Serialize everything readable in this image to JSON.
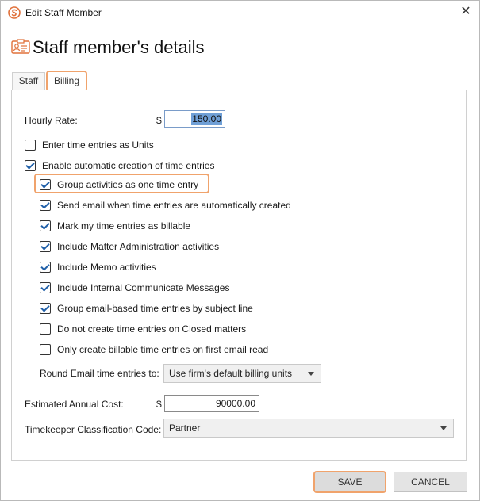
{
  "window": {
    "title": "Edit Staff Member"
  },
  "header": {
    "title": "Staff member's details"
  },
  "tabs": [
    {
      "label": "Staff",
      "active": false
    },
    {
      "label": "Billing",
      "active": true
    }
  ],
  "billing": {
    "hourly_rate_label": "Hourly Rate:",
    "currency_symbol": "$",
    "hourly_rate_value": "150.00",
    "options": [
      {
        "label": "Enter time entries as Units",
        "checked": false
      },
      {
        "label": "Enable automatic creation of time entries",
        "checked": true
      },
      {
        "label": "Group activities as one time entry",
        "checked": true
      },
      {
        "label": "Send email when time entries are automatically created",
        "checked": true
      },
      {
        "label": "Mark my time entries as billable",
        "checked": true
      },
      {
        "label": "Include Matter Administration activities",
        "checked": true
      },
      {
        "label": "Include Memo activities",
        "checked": true
      },
      {
        "label": "Include Internal Communicate Messages",
        "checked": true
      },
      {
        "label": "Group email-based time entries by subject line",
        "checked": true
      },
      {
        "label": "Do not create time entries on Closed matters",
        "checked": false
      },
      {
        "label": "Only create billable time entries on first email read",
        "checked": false
      }
    ],
    "round_label": "Round Email time entries to:",
    "round_value": "Use firm's default billing units",
    "annual_cost_label": "Estimated Annual Cost:",
    "annual_cost_value": "90000.00",
    "timekeeper_label": "Timekeeper Classification Code:",
    "timekeeper_value": "Partner"
  },
  "footer": {
    "save_label": "SAVE",
    "cancel_label": "CANCEL"
  },
  "colors": {
    "highlight": "#f0a36c",
    "brand": "#e0703a",
    "selection": "#6f9fd6"
  }
}
